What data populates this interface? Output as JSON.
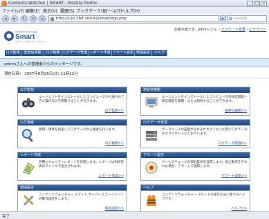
{
  "window": {
    "title": "Contents Watcher | SMART - Mozilla Firefox"
  },
  "menu": [
    "ファイル(F)",
    "編集(E)",
    "表示(V)",
    "履歴(S)",
    "ブックマーク(B)",
    "ツール(T)",
    "ヘルプ(H)"
  ],
  "nav": {
    "url": "http://192.168.100.41/smart/top.php",
    "search_placeholder": "Google",
    "search_g": "G"
  },
  "header": {
    "logo_small": "CONTENTS WATCHER",
    "logo_main": "Smart",
    "logo_sub": "コンテンツウォッチャー スマート",
    "login_text": "お疲れ様です。admin さん",
    "password_change": "パスワード変更",
    "logout": "ログアウト"
  },
  "tabs": [
    "ログ監視",
    "送受信検閲",
    "ログ検索",
    "ログデータ管理",
    "レポート作成",
    "アラート設定",
    "環境設定",
    "ヘルプ"
  ],
  "welcome": "adminさんへの管理者からのメッセージです。",
  "date_line": "現在日時： 2007年9月26日(水) 11時12分",
  "panels": [
    {
      "title": "ログ監視",
      "desc": "エージェントをインストールしたコンピュータから送られてきた操作ログを閲覧することができます。",
      "link": "ログ監視>>",
      "icon": "binoculars-icon"
    },
    {
      "title": "送受信検閲",
      "desc": "エージェントをインストールしたコンピュータの送信履歴・受信履歴を検閲、または削除することができます。",
      "link": "送受信検閲>>",
      "icon": "monitor-icon"
    },
    {
      "title": "ログ検索",
      "desc": "期間・項目を指定してログデータから検索を行います。",
      "link": "ログ検索>>",
      "icon": "magnifier-icon"
    },
    {
      "title": "ログデータ管理",
      "desc": "データベースの容量がそれぞれ大きくなった際にログデータのエクスポートなどを行います。",
      "link": "ログデータ管理>>",
      "icon": "database-icon"
    },
    {
      "title": "レポート作成",
      "desc": "各種セキュリティレポートを作成します。レポートはPDF形式のファイルで出力されます。",
      "link": "レポート作成>>",
      "icon": "report-icon"
    },
    {
      "title": "アラート設定",
      "desc": "ウイルスチェックの常駐監視を設定します。禁止動作を行われた場合、アラートで通知します。",
      "link": "アラート設定>>",
      "icon": "alert-icon"
    },
    {
      "title": "環境設定",
      "desc": "コンテンツウォッチャー スマート サーバー とエージェントの動作設定をします。",
      "link": "環境設定>>",
      "icon": "tools-icon"
    },
    {
      "title": "ヘルプ",
      "desc": "コンテンツウォッチャー スマートの操作方法に関するヘルプです。",
      "link": "ヘルプ>>",
      "icon": "lifejacket-icon"
    }
  ],
  "status": "完了",
  "colors": {
    "tab": "#2a5590",
    "panel_header": "#2d5a96",
    "welcome_bg": "#d9e9f7",
    "link": "#1a4fa0"
  }
}
